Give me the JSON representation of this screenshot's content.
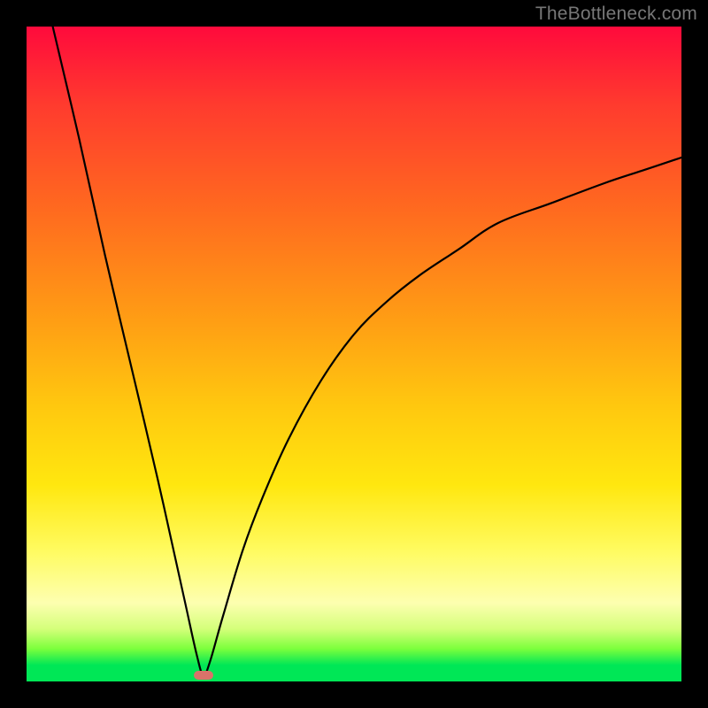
{
  "watermark_text": "TheBottleneck.com",
  "colors": {
    "frame": "#000000",
    "curve_stroke": "#000000",
    "marker_fill": "#d9736a",
    "watermark": "#777777"
  },
  "chart_data": {
    "type": "line",
    "title": "",
    "xlabel": "",
    "ylabel": "",
    "xlim": [
      0,
      100
    ],
    "ylim": [
      0,
      100
    ],
    "grid": false,
    "legend": false,
    "note": "V-shaped bottleneck curve. Minimum (≈0) near x≈27. Left branch rises steeply to y≈100 at x≈4. Right branch rises with decreasing slope to y≈80 at x=100. Values estimated from pixels; no axis ticks shown.",
    "series": [
      {
        "name": "bottleneck-curve",
        "x": [
          4,
          8,
          12,
          16,
          20,
          24,
          26,
          27,
          28,
          30,
          33,
          36,
          40,
          45,
          50,
          55,
          60,
          66,
          72,
          80,
          88,
          94,
          100
        ],
        "y": [
          100,
          83,
          65,
          48,
          31,
          13,
          4,
          1,
          3,
          10,
          20,
          28,
          37,
          46,
          53,
          58,
          62,
          66,
          70,
          73,
          76,
          78,
          80
        ]
      }
    ],
    "marker": {
      "x": 27,
      "y": 1,
      "shape": "rounded-rect"
    }
  }
}
